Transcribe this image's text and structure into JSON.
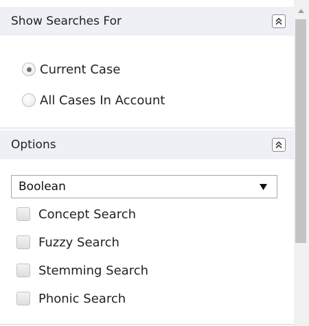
{
  "show_searches": {
    "title": "Show Searches For",
    "options": [
      {
        "label": "Current Case",
        "checked": true
      },
      {
        "label": "All Cases In Account",
        "checked": false
      }
    ]
  },
  "options_section": {
    "title": "Options",
    "search_type": {
      "selected": "Boolean"
    },
    "checkboxes": [
      {
        "label": "Concept Search",
        "checked": false
      },
      {
        "label": "Fuzzy Search",
        "checked": false
      },
      {
        "label": "Stemming Search",
        "checked": false
      },
      {
        "label": "Phonic Search",
        "checked": false
      }
    ]
  },
  "icons": {
    "collapse": "double-chevron-up-icon",
    "dropdown": "triangle-down-icon",
    "scroll_up": "scroll-up-arrow-icon"
  },
  "colors": {
    "header_bg": "#eef0f5",
    "scroll_thumb": "#c4c4c4",
    "text": "#222222"
  }
}
